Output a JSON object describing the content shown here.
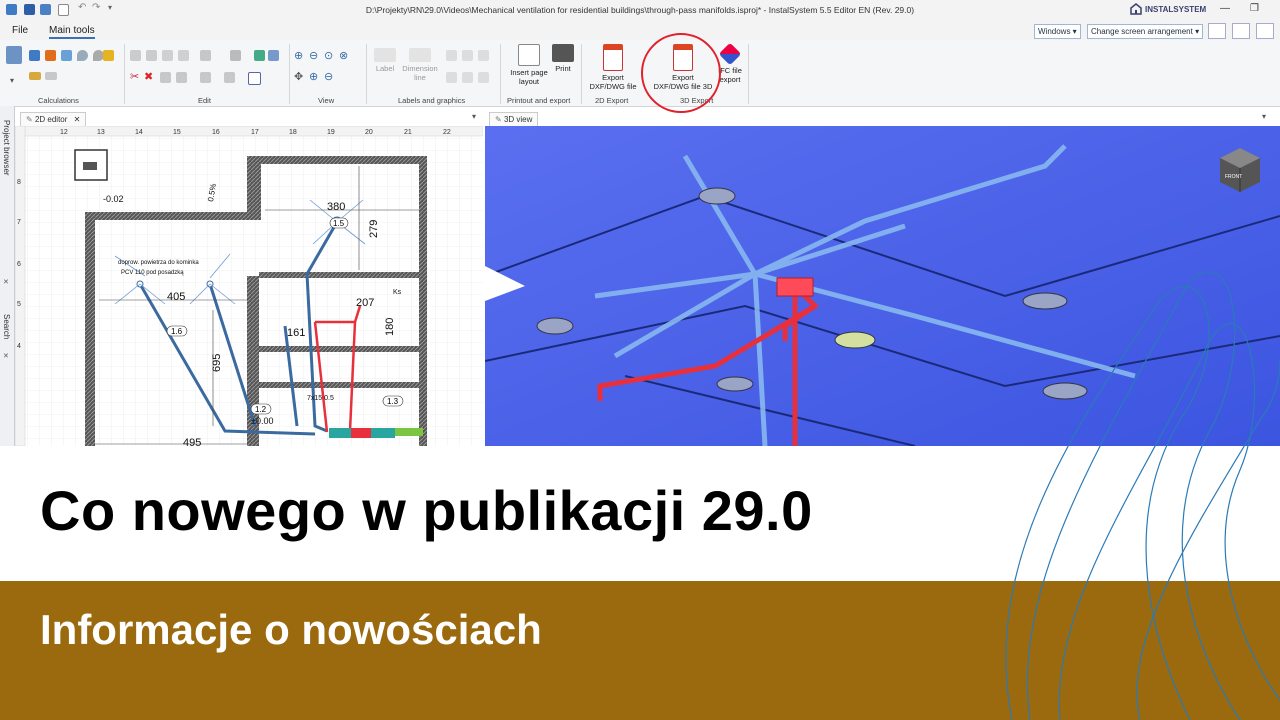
{
  "window": {
    "title": "D:\\Projekty\\RN\\29.0\\Videos\\Mechanical ventilation for residential buildings\\through-pass manifolds.isproj* - InstalSystem 5.5 Editor EN (Rev. 29.0)",
    "brand": "INSTALSYSTEM"
  },
  "menu": {
    "file": "File",
    "main_tools": "Main tools",
    "windows_dropdown": "Windows",
    "arrangement_dropdown": "Change screen arrangement"
  },
  "ribbon": {
    "groups": {
      "calculations": "Calculations",
      "edit": "Edit",
      "view": "View",
      "labels_graphics": "Labels and graphics",
      "printout_export": "Printout and export",
      "export_2d": "2D Export",
      "export_3d": "3D Export"
    },
    "buttons": {
      "label": "Label",
      "dimension_line_1": "Dimension",
      "dimension_line_2": "line",
      "insert_page_layout_1": "Insert page",
      "insert_page_layout_2": "layout",
      "print": "Print",
      "export_dxf_2d_1": "Export",
      "export_dxf_2d_2": "DXF/DWG file",
      "export_dxf_3d_1": "Export",
      "export_dxf_3d_2": "DXF/DWG file 3D",
      "ifc_export_1": "IFC file",
      "ifc_export_2": "export"
    }
  },
  "side_panel": {
    "project_browser": "Project browser",
    "search": "Search"
  },
  "editor2d": {
    "tab_label": "2D editor",
    "ruler_labels": [
      "12",
      "13",
      "14",
      "15",
      "16",
      "17",
      "18",
      "19",
      "20",
      "21",
      "22"
    ],
    "side_ruler_labels": [
      "8",
      "7",
      "6",
      "5",
      "4"
    ],
    "dimension_labels": [
      "380",
      "279",
      "405",
      "695",
      "207",
      "180",
      "161",
      "495"
    ],
    "level_labels": [
      "-0.02",
      "0.5%",
      "±0.00",
      "Ks"
    ],
    "tag_labels": [
      "1.5",
      "1.6",
      "1.2",
      "1.3"
    ],
    "room_note_1": "doprow. powietrza do kominka",
    "room_note_2": "PCV 110 pod posadzką",
    "duct_note": "7x15 0.5"
  },
  "view3d": {
    "tab_label": "3D view",
    "cube_label": "FRONT"
  },
  "footer": {
    "heading": "Co nowego w publikacji 29.0",
    "subheading": "Informacje o nowościach"
  },
  "colors": {
    "band": "#9b6a0e",
    "view3d_bg": "#4d66e8",
    "highlight": "#e0202a",
    "duct_supply": "#e8303c",
    "duct_blue": "#3b6aa0"
  }
}
